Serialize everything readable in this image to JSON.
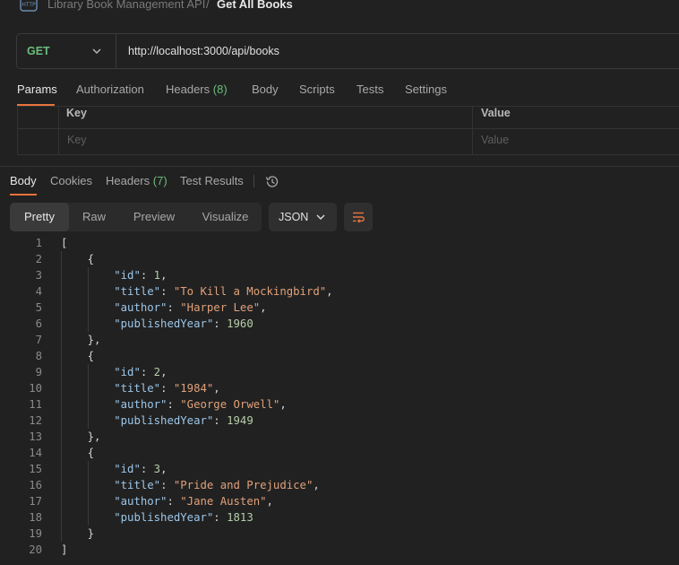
{
  "breadcrumb": {
    "icon": "http-icon",
    "parent": "Library Book Management API",
    "separator": "/",
    "title": "Get All Books"
  },
  "request": {
    "method": "GET",
    "url": "http://localhost:3000/api/books"
  },
  "request_tabs": [
    {
      "label": "Params"
    },
    {
      "label": "Authorization"
    },
    {
      "label": "Headers",
      "count": "(8)"
    },
    {
      "label": "Body"
    },
    {
      "label": "Scripts"
    },
    {
      "label": "Tests"
    },
    {
      "label": "Settings"
    }
  ],
  "params_table": {
    "headers": [
      "Key",
      "Value"
    ],
    "placeholders": [
      "Key",
      "Value"
    ]
  },
  "response_tabs": [
    {
      "label": "Body"
    },
    {
      "label": "Cookies"
    },
    {
      "label": "Headers",
      "count": "(7)"
    },
    {
      "label": "Test Results"
    }
  ],
  "view_modes": [
    "Pretty",
    "Raw",
    "Preview",
    "Visualize"
  ],
  "format": "JSON",
  "code_lines": [
    "[",
    "    {",
    "        \"id\": 1,",
    "        \"title\": \"To Kill a Mockingbird\",",
    "        \"author\": \"Harper Lee\",",
    "        \"publishedYear\": 1960",
    "    },",
    "    {",
    "        \"id\": 2,",
    "        \"title\": \"1984\",",
    "        \"author\": \"George Orwell\",",
    "        \"publishedYear\": 1949",
    "    },",
    "    {",
    "        \"id\": 3,",
    "        \"title\": \"Pride and Prejudice\",",
    "        \"author\": \"Jane Austen\",",
    "        \"publishedYear\": 1813",
    "    }",
    "]"
  ],
  "colors": {
    "accent": "#e8743b",
    "method_get": "#6bbd7b",
    "json_key": "#9cc6e8",
    "json_string": "#e0a17a",
    "json_number": "#b5cea8"
  }
}
